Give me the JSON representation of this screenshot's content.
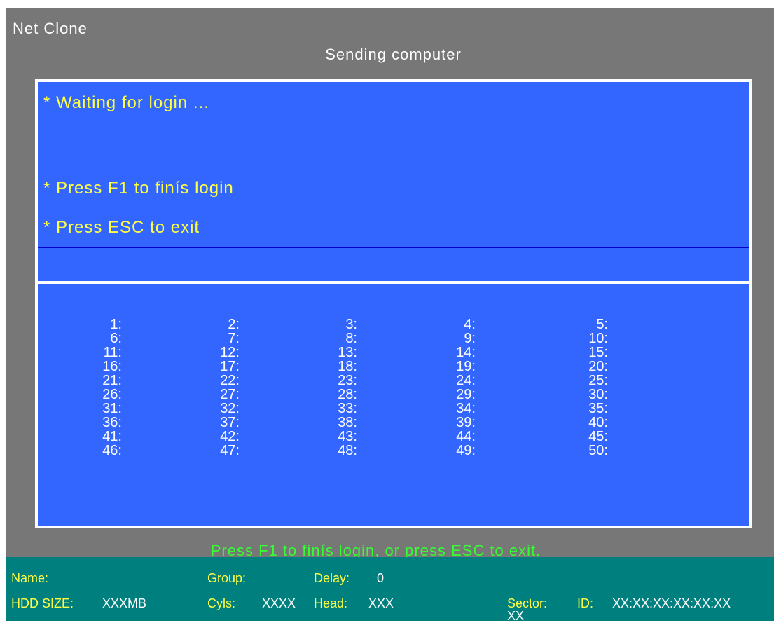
{
  "app": {
    "title": "Net Clone",
    "subtitle": "Sending computer"
  },
  "messages": {
    "line1": "* Waiting for login ...",
    "line2": "* Press F1 to finís login",
    "line3": "* Press ESC to exit"
  },
  "slots": {
    "col1": [
      "1:",
      "6:",
      "11:",
      "16:",
      "21:",
      "26:",
      "31:",
      "36:",
      "41:",
      "46:"
    ],
    "col2": [
      "2:",
      "7:",
      "12:",
      "17:",
      "22:",
      "27:",
      "32:",
      "37:",
      "42:",
      "47:"
    ],
    "col3": [
      "3:",
      "8:",
      "13:",
      "18:",
      "23:",
      "28:",
      "33:",
      "38:",
      "43:",
      "48:"
    ],
    "col4": [
      "4:",
      "9:",
      "14:",
      "19:",
      "24:",
      "29:",
      "34:",
      "39:",
      "44:",
      "49:"
    ],
    "col5": [
      "5:",
      "10:",
      "15:",
      "20:",
      "25:",
      "30:",
      "35:",
      "40:",
      "45:",
      "50:"
    ]
  },
  "hint": "Press F1 to finís login, or press ESC to exit.",
  "info": {
    "name_label": "Name:",
    "group_label": "Group:",
    "delay_label": "Delay:",
    "delay_value": "0",
    "hdd_label": "HDD SIZE:",
    "hdd_value": "XXXMB",
    "cyls_label": "Cyls:",
    "cyls_value": "XXXX",
    "head_label": "Head:",
    "head_value": "XXX",
    "sector_label": "Sector:",
    "sector_value": "XX",
    "id_label": "ID:",
    "id_value": "XX:XX:XX:XX:XX:XX"
  },
  "colors": {
    "screen_bg": "#777777",
    "panel_bg": "#3366ff",
    "message_text": "#ffff44",
    "hint_text": "#33ff33",
    "info_bar_bg": "#007f7f"
  }
}
